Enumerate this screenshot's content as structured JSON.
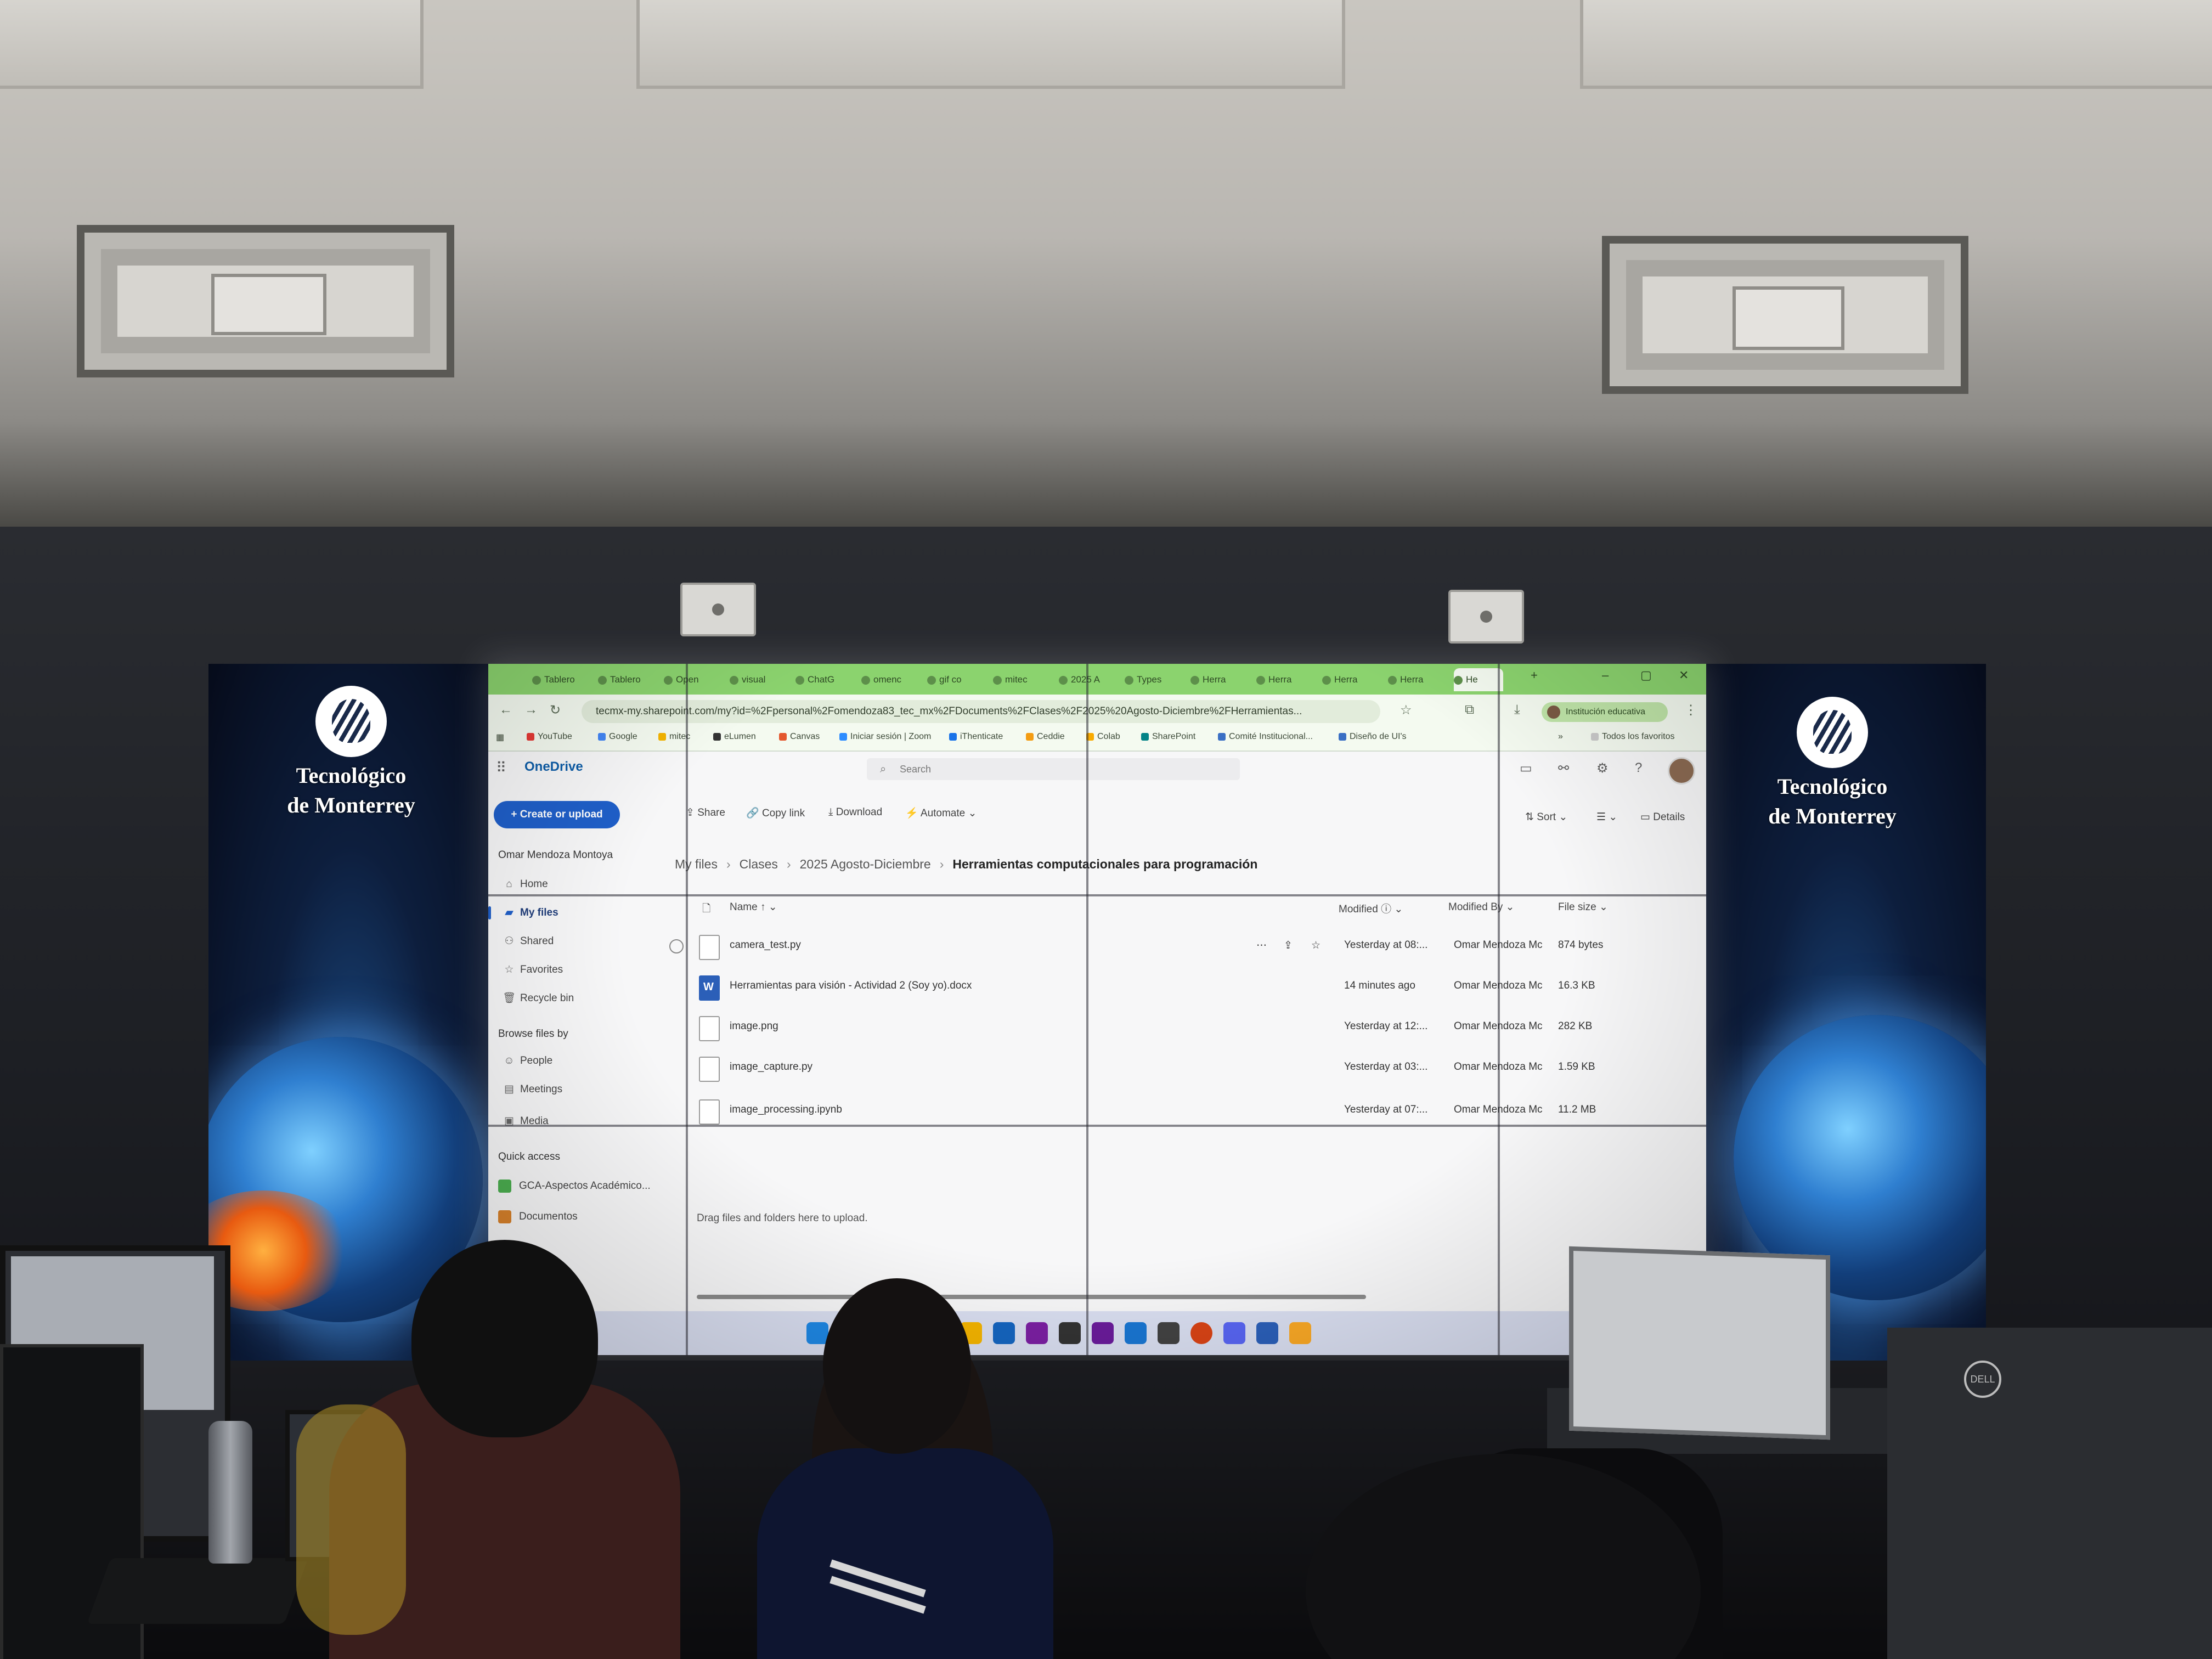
{
  "browser": {
    "tabs": [
      {
        "label": "Tablero"
      },
      {
        "label": "Tablero"
      },
      {
        "label": "Open"
      },
      {
        "label": "visual"
      },
      {
        "label": "ChatG"
      },
      {
        "label": "omenc"
      },
      {
        "label": "gif co"
      },
      {
        "label": "mitec"
      },
      {
        "label": "2025 A"
      },
      {
        "label": "Types"
      },
      {
        "label": "Herra"
      },
      {
        "label": "Herra"
      },
      {
        "label": "Herra"
      },
      {
        "label": "Herra"
      },
      {
        "label": "He"
      }
    ],
    "new_tab": "+",
    "window_controls": [
      "–",
      "▢",
      "✕"
    ],
    "url": "tecmx-my.sharepoint.com/my?id=%2Fpersonal%2Fomendoza83_tec_mx%2FDocuments%2FClases%2F2025%20Agosto-Diciembre%2FHerramientas...",
    "profile_label": "Institución educativa",
    "bookmarks": [
      {
        "label": "YouTube",
        "color": "#e53935"
      },
      {
        "label": "Google",
        "color": "#4285f4"
      },
      {
        "label": "mitec",
        "color": "#f4b400"
      },
      {
        "label": "eLumen",
        "color": "#333333"
      },
      {
        "label": "Canvas",
        "color": "#e4572e"
      },
      {
        "label": "Iniciar sesión | Zoom",
        "color": "#2d8cff"
      },
      {
        "label": "iThenticate",
        "color": "#1a73e8"
      },
      {
        "label": "Ceddie",
        "color": "#f39c12"
      },
      {
        "label": "Colab",
        "color": "#f9ab00"
      },
      {
        "label": "SharePoint",
        "color": "#038387"
      },
      {
        "label": "Comité Institucional...",
        "color": "#3a6fc4"
      },
      {
        "label": "Diseño de UI's",
        "color": "#3a6fc4"
      }
    ],
    "bookmarks_more": "»",
    "all_bookmarks": "Todos los favoritos"
  },
  "onedrive": {
    "brand": "OneDrive",
    "search_placeholder": "Search",
    "create_button": "Create or upload",
    "owner": "Omar Mendoza Montoya",
    "nav": [
      {
        "label": "Home",
        "icon": "home-icon"
      },
      {
        "label": "My files",
        "icon": "folder-icon",
        "active": true
      },
      {
        "label": "Shared",
        "icon": "people-icon"
      },
      {
        "label": "Favorites",
        "icon": "star-icon"
      },
      {
        "label": "Recycle bin",
        "icon": "trash-icon"
      }
    ],
    "browse_heading": "Browse files by",
    "browse": [
      {
        "label": "People",
        "icon": "person-icon"
      },
      {
        "label": "Meetings",
        "icon": "calendar-icon"
      },
      {
        "label": "Media",
        "icon": "image-icon"
      }
    ],
    "quick_access_heading": "Quick access",
    "quick_access": [
      {
        "label": "GCA-Aspectos Académico...",
        "color": "#4caf50"
      },
      {
        "label": "Documentos",
        "color": "#d9822b"
      }
    ],
    "commands": [
      "Share",
      "Copy link",
      "Download",
      "Automate"
    ],
    "view_controls": [
      "Sort",
      "Details"
    ],
    "breadcrumb": [
      "My files",
      "Clases",
      "2025 Agosto-Diciembre",
      "Herramientas computacionales para programación"
    ],
    "columns": {
      "name": "Name",
      "name_sort": "↑",
      "modified": "Modified",
      "modified_by": "Modified By",
      "file_size": "File size"
    },
    "files": [
      {
        "name": "camera_test.py",
        "modified": "Yesterday at 08:...",
        "modified_by": "Omar Mendoza Mc",
        "size": "874 bytes",
        "type": "code"
      },
      {
        "name": "Herramientas para visión - Actividad 2 (Soy yo).docx",
        "modified": "14 minutes ago",
        "modified_by": "Omar Mendoza Mc",
        "size": "16.3 KB",
        "type": "word"
      },
      {
        "name": "image.png",
        "modified": "Yesterday at 12:...",
        "modified_by": "Omar Mendoza Mc",
        "size": "282 KB",
        "type": "image"
      },
      {
        "name": "image_capture.py",
        "modified": "Yesterday at 03:...",
        "modified_by": "Omar Mendoza Mc",
        "size": "1.59 KB",
        "type": "code"
      },
      {
        "name": "image_processing.ipynb",
        "modified": "Yesterday at 07:...",
        "modified_by": "Omar Mendoza Mc",
        "size": "11.2 MB",
        "type": "notebook"
      }
    ],
    "drag_hint": "Drag files and folders here to upload."
  },
  "wall": {
    "logo_line1": "Tecnológico",
    "logo_line2": "de Monterrey"
  },
  "taskbar": {
    "icons": [
      {
        "name": "windows-start-icon",
        "color": "#1e88e5"
      },
      {
        "name": "folder-app-icon",
        "color": "#f4b400"
      },
      {
        "name": "outlook-icon",
        "color": "#1565c0"
      },
      {
        "name": "onenote-icon",
        "color": "#7b1fa2"
      },
      {
        "name": "github-icon",
        "color": "#333333"
      },
      {
        "name": "visual-studio-icon",
        "color": "#6a1b9a"
      },
      {
        "name": "vscode-icon",
        "color": "#1976d2"
      },
      {
        "name": "terminal-icon",
        "color": "#424242"
      },
      {
        "name": "powerpoint-icon",
        "color": "#d84315"
      },
      {
        "name": "discord-icon",
        "color": "#5865f2"
      },
      {
        "name": "word-icon",
        "color": "#2b5fb8"
      },
      {
        "name": "python-icon",
        "color": "#f9a825"
      }
    ]
  },
  "room": {
    "dell_badge": "DELL"
  }
}
